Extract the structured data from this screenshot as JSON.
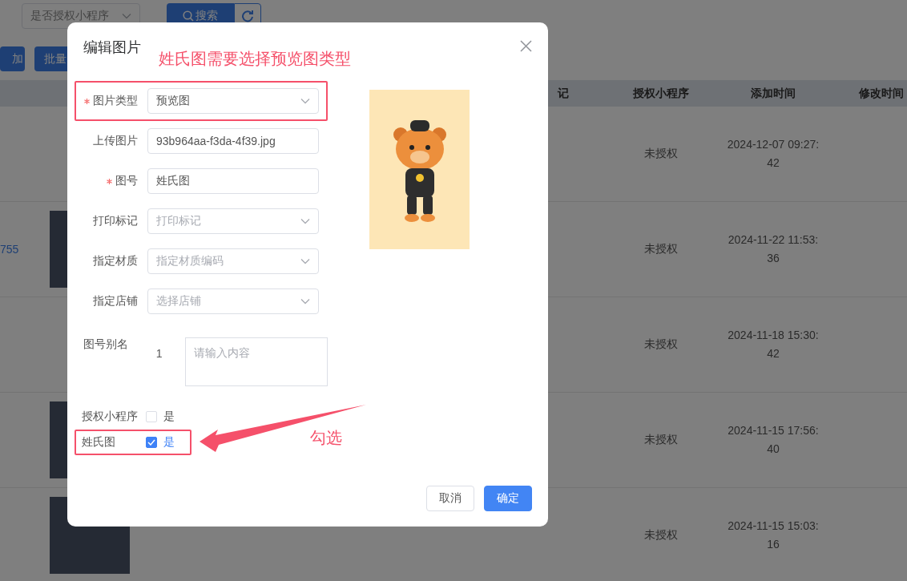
{
  "background_page": {
    "filter_select": {
      "placeholder": "是否授权小程序"
    },
    "search_button": "搜索",
    "toolbar_buttons": [
      "加",
      "批量"
    ],
    "table": {
      "columns": [
        "记",
        "授权小程序",
        "添加时间",
        "修改时间"
      ],
      "rows": [
        {
          "link": "",
          "photo": false,
          "authorization": "未授权",
          "added": "2024-12-07 09:27:42"
        },
        {
          "link": "755",
          "photo": true,
          "authorization": "未授权",
          "added": "2024-11-22 11:53:36"
        },
        {
          "link": "",
          "photo": false,
          "authorization": "未授权",
          "added": "2024-11-18 15:30:42"
        },
        {
          "link": "",
          "photo": true,
          "authorization": "未授权",
          "added": "2024-11-15 17:56:40"
        },
        {
          "link": "",
          "photo": true,
          "authorization": "未授权",
          "added": "2024-11-15 15:03:16"
        }
      ]
    }
  },
  "dialog": {
    "title": "编辑图片",
    "fields": [
      {
        "label": "图片类型",
        "required": true,
        "kind": "select",
        "value": "预览图",
        "highlighted": true
      },
      {
        "label": "上传图片",
        "required": false,
        "kind": "input",
        "value": "93b964aa-f3da-4f39.jpg",
        "highlighted": false
      },
      {
        "label": "图号",
        "required": true,
        "kind": "input",
        "value": "姓氏图",
        "highlighted": false
      },
      {
        "label": "打印标记",
        "required": false,
        "kind": "select",
        "placeholder": "打印标记",
        "highlighted": false
      },
      {
        "label": "指定材质",
        "required": false,
        "kind": "select",
        "placeholder": "指定材质编码",
        "highlighted": false
      },
      {
        "label": "指定店铺",
        "required": false,
        "kind": "select",
        "placeholder": "选择店铺",
        "highlighted": false
      }
    ],
    "alias": {
      "label": "图号别名",
      "index": "1",
      "placeholder": "请输入内容"
    },
    "checkboxes": [
      {
        "label": "授权小程序",
        "option": "是",
        "checked": false,
        "highlighted": false
      },
      {
        "label": "姓氏图",
        "option": "是",
        "checked": true,
        "highlighted": true
      }
    ],
    "buttons": [
      {
        "label": "取消",
        "kind": "default"
      },
      {
        "label": "确定",
        "kind": "primary"
      }
    ]
  },
  "annotations": {
    "heading": "姓氏图需要选择预览图类型",
    "arrow_note": "勾选"
  }
}
